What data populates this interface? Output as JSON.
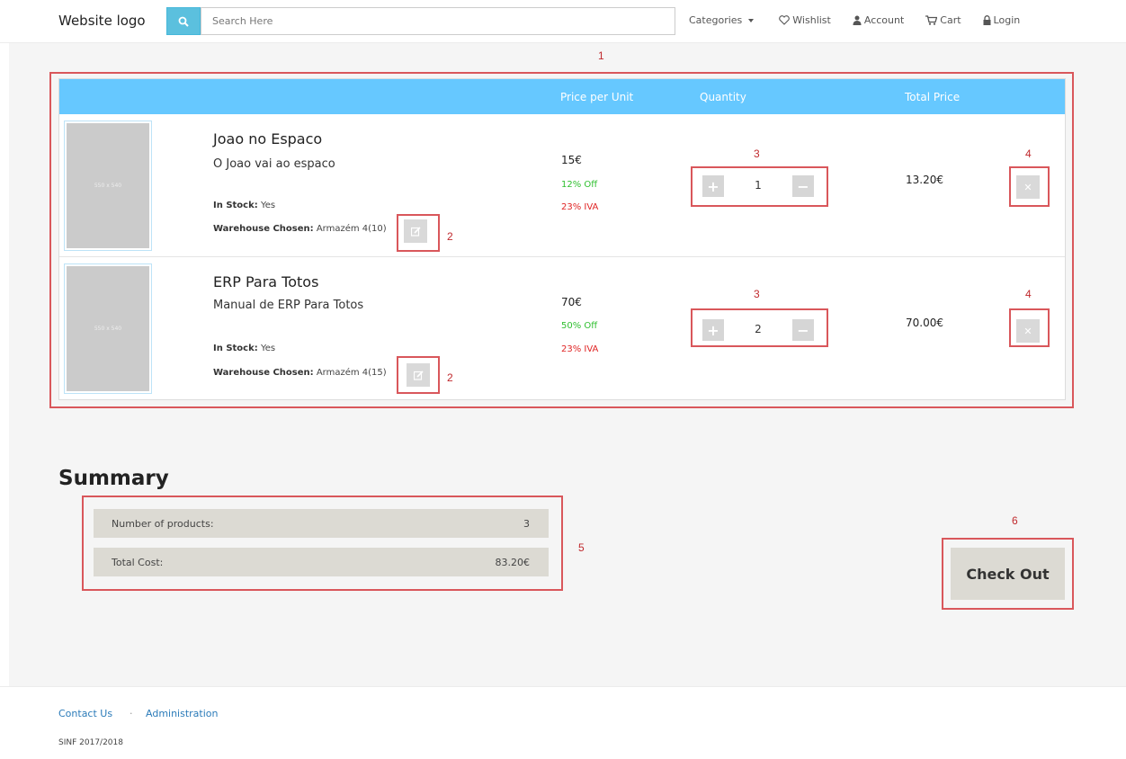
{
  "navbar": {
    "logo": "Website logo",
    "search_placeholder": "Search Here",
    "links": [
      {
        "label": "Categories",
        "icon": "caret-down-icon"
      },
      {
        "label": "Wishlist",
        "icon": "heart-icon"
      },
      {
        "label": "Account",
        "icon": "user-icon"
      },
      {
        "label": "Cart",
        "icon": "cart-icon"
      },
      {
        "label": "Login",
        "icon": "lock-icon"
      }
    ]
  },
  "cart": {
    "columns": {
      "price": "Price per Unit",
      "quantity": "Quantity",
      "total": "Total Price"
    },
    "items": [
      {
        "name": "Joao no Espaco",
        "description": "O Joao vai ao espaco",
        "image_placeholder": "550 x 540",
        "stock_label": "In Stock:",
        "stock_value": "Yes",
        "warehouse_label": "Warehouse Chosen:",
        "warehouse_value": "Armazém 4(10)",
        "price": "15€",
        "discount": "12% Off",
        "tax": "23% IVA",
        "quantity": "1",
        "total": "13.20€"
      },
      {
        "name": "ERP Para Totos",
        "description": "Manual de ERP Para Totos",
        "image_placeholder": "550 x 540",
        "stock_label": "In Stock:",
        "stock_value": "Yes",
        "warehouse_label": "Warehouse Chosen:",
        "warehouse_value": "Armazém 4(15)",
        "price": "70€",
        "discount": "50% Off",
        "tax": "23% IVA",
        "quantity": "2",
        "total": "70.00€"
      }
    ]
  },
  "summary": {
    "title": "Summary",
    "products_label": "Number of products:",
    "products_value": "3",
    "cost_label": "Total Cost:",
    "cost_value": "83.20€",
    "checkout_label": "Check Out"
  },
  "annotations": {
    "n1": "1",
    "n2": "2",
    "n3": "3",
    "n4": "4",
    "n5": "5",
    "n6": "6"
  },
  "footer": {
    "contact": "Contact Us",
    "separator": "·",
    "admin": "Administration",
    "copyright": "SINF 2017/2018"
  },
  "colors": {
    "header_blue": "#66c8ff",
    "annotation_red": "#d9575b",
    "discount_green": "#2fbf2f",
    "tax_red": "#e02525",
    "link_blue": "#2b7bb9"
  }
}
